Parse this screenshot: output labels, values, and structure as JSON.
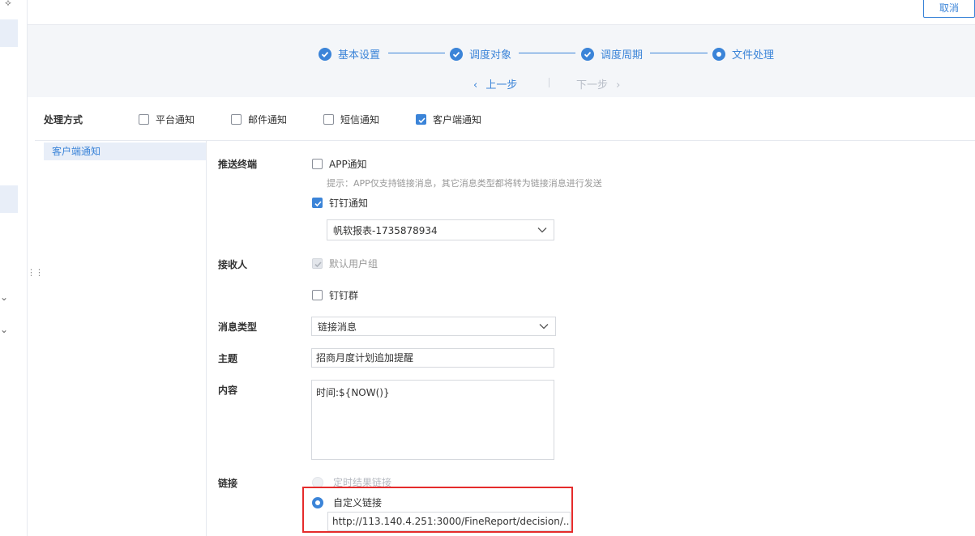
{
  "toolbar": {
    "cancel_label": "取消"
  },
  "steps": [
    {
      "label": "基本设置",
      "state": "done"
    },
    {
      "label": "调度对象",
      "state": "done"
    },
    {
      "label": "调度周期",
      "state": "done"
    },
    {
      "label": "文件处理",
      "state": "current"
    }
  ],
  "nav": {
    "prev_label": "上一步",
    "next_label": "下一步"
  },
  "processing": {
    "label": "处理方式",
    "options": [
      {
        "label": "平台通知",
        "checked": false
      },
      {
        "label": "邮件通知",
        "checked": false
      },
      {
        "label": "短信通知",
        "checked": false
      },
      {
        "label": "客户端通知",
        "checked": true
      }
    ]
  },
  "sub_nav": {
    "active": "客户端通知"
  },
  "form": {
    "push_terminal": {
      "label": "推送终端",
      "app_label": "APP通知",
      "app_checked": false,
      "hint": "提示：APP仅支持链接消息，其它消息类型都将转为链接消息进行发送",
      "dingtalk_label": "钉钉通知",
      "dingtalk_checked": true,
      "dingtalk_app": "帆软报表-1735878934"
    },
    "receiver": {
      "label": "接收人",
      "default_group": "默认用户组",
      "dingtalk_group": "钉钉群"
    },
    "message_type": {
      "label": "消息类型",
      "value": "链接消息"
    },
    "subject": {
      "label": "主题",
      "value": "招商月度计划追加提醒"
    },
    "content": {
      "label": "内容",
      "value": "时间:${NOW()}"
    },
    "link": {
      "label": "链接",
      "option_scheduled": "定时结果链接",
      "option_custom": "自定义链接",
      "selected": "自定义链接",
      "url": "http://113.140.4.251:3000/FineReport/decision/..."
    }
  },
  "colors": {
    "accent": "#3b84d8",
    "highlight": "#e52b2b",
    "step_bg": "#f4f6f9"
  }
}
